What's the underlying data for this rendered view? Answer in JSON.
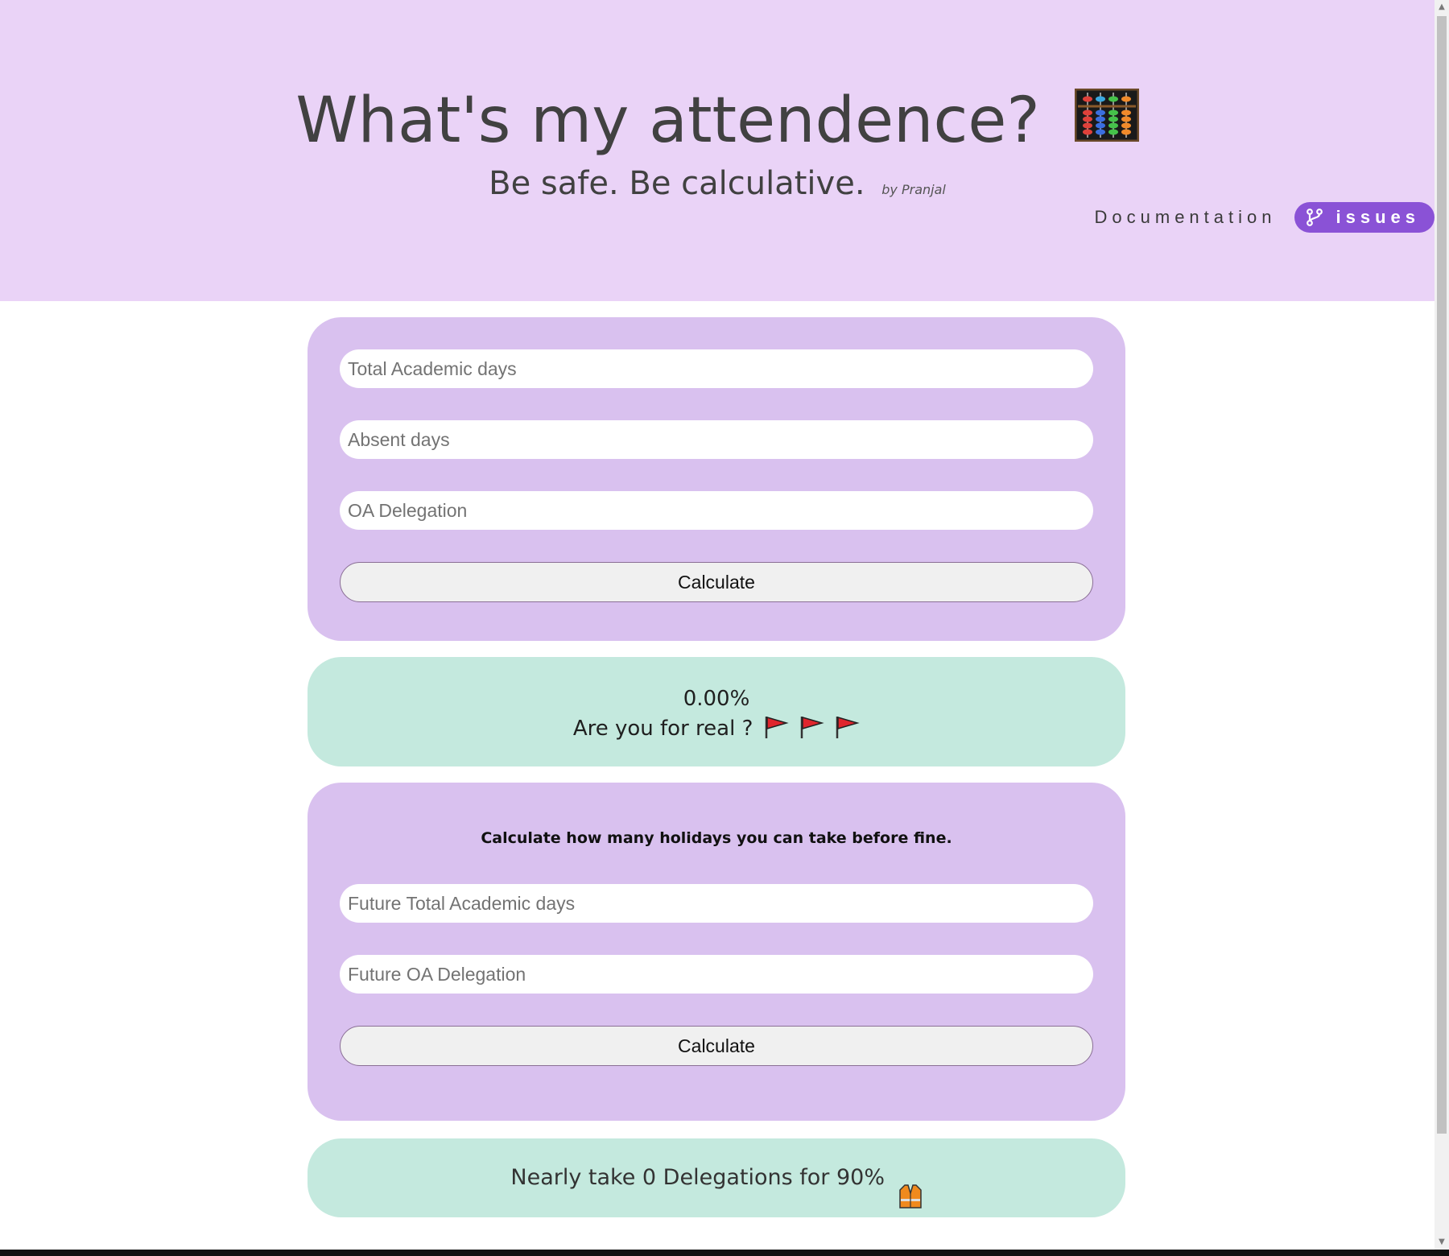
{
  "header": {
    "title": "What's my attendence?",
    "title_icon": "abacus-icon",
    "subtitle": "Be safe. Be calculative.",
    "byline": "by Pranjal",
    "nav": {
      "documentation_label": "Documentation",
      "issues_label": "issues",
      "issues_icon": "git-branch-icon"
    }
  },
  "attendance_form": {
    "total_days_placeholder": "Total Academic days",
    "absent_days_placeholder": "Absent days",
    "oa_delegation_placeholder": "OA Delegation",
    "calculate_label": "Calculate"
  },
  "attendance_result": {
    "percentage": "0.00%",
    "message": "Are you for real ?",
    "message_icon": "red-flag-icon",
    "flag_count": 3
  },
  "holiday_form": {
    "heading": "Calculate how many holidays you can take before fine.",
    "future_total_days_placeholder": "Future Total Academic days",
    "future_oa_delegation_placeholder": "Future OA Delegation",
    "calculate_label": "Calculate"
  },
  "holiday_result": {
    "message": "Nearly take 0 Delegations for 90%",
    "message_icon": "safety-vest-icon"
  },
  "colors": {
    "header_bg": "#ead3f7",
    "card_purple": "#d9c1ef",
    "card_green": "#c4e9de",
    "issues_button": "#8a52d6"
  }
}
